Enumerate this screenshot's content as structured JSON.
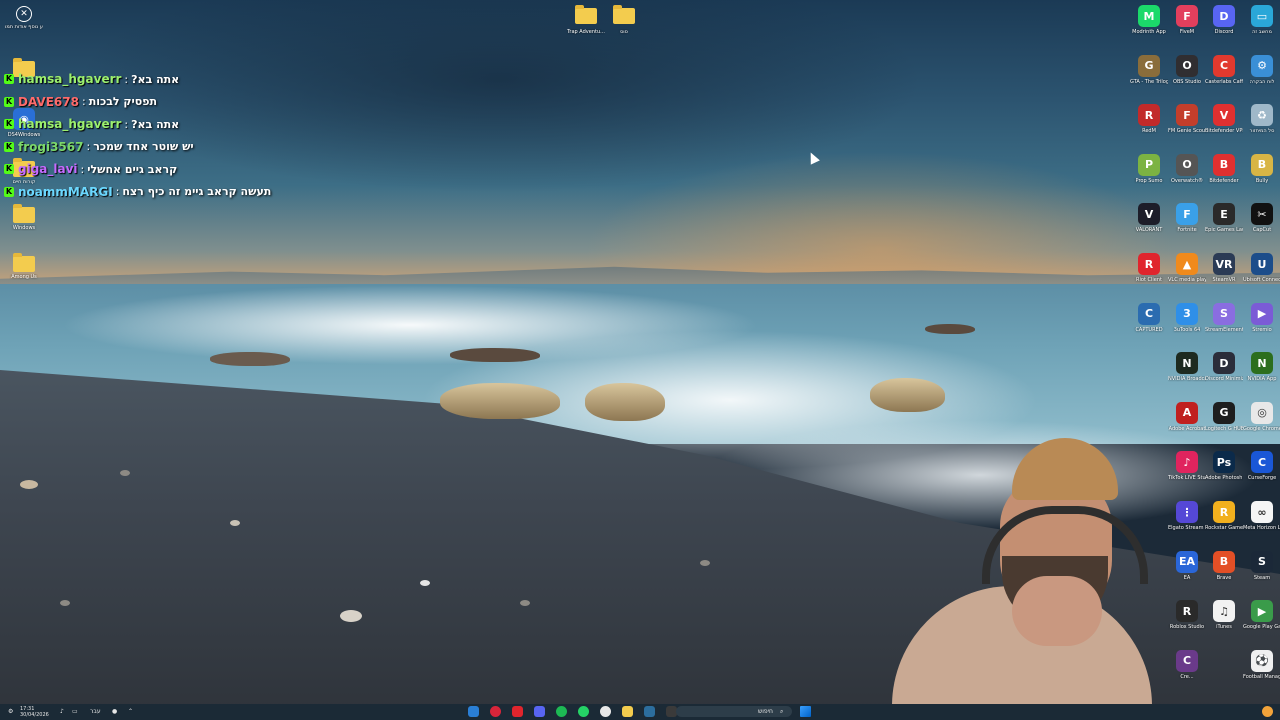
{
  "desktop": {
    "top_left_icons": [
      {
        "label": "מידע נוסף אודות תמו",
        "icon": "info-icon",
        "color": "#ffffff"
      },
      {
        "label": "",
        "icon": "folder-icon",
        "color": "#f3cc4e"
      },
      {
        "label": "DS4Windows",
        "icon": "gamepad-icon",
        "color": "#2a6fd6"
      },
      {
        "label": "קורות חיים",
        "icon": "folder-icon",
        "color": "#f3cc4e"
      },
      {
        "label": "Windows",
        "icon": "folder-icon",
        "color": "#f3cc4e"
      },
      {
        "label": "Among Us",
        "icon": "folder-icon",
        "color": "#f3cc4e"
      }
    ],
    "top_center_icons": [
      {
        "label": "Trap Adventu...",
        "icon": "folder-icon"
      },
      {
        "label": "סוס",
        "icon": "folder-icon"
      }
    ],
    "right_icons": [
      [
        {
          "label": "Modrinth App",
          "glyph": "M",
          "color": "#1bd96a"
        },
        {
          "label": "FiveM",
          "glyph": "F",
          "color": "#e23f5d"
        },
        {
          "label": "Discord",
          "glyph": "D",
          "color": "#5865f2"
        },
        {
          "label": "מחשב זה",
          "glyph": "▭",
          "color": "#2aa7d8"
        }
      ],
      [
        {
          "label": "GTA - The Trilogy - DE",
          "glyph": "G",
          "color": "#8a6d3b"
        },
        {
          "label": "OBS Studio",
          "glyph": "O",
          "color": "#302e31"
        },
        {
          "label": "Casterlabs Caffeinated",
          "glyph": "C",
          "color": "#e1392e"
        },
        {
          "label": "לוח הבקרה",
          "glyph": "⚙",
          "color": "#3a8fd6"
        }
      ],
      [
        {
          "label": "RedM",
          "glyph": "R",
          "color": "#c22a2a"
        },
        {
          "label": "FM Genie Scout 26g",
          "glyph": "F",
          "color": "#c33e2b"
        },
        {
          "label": "Bitdefender VPN",
          "glyph": "V",
          "color": "#e03030"
        },
        {
          "label": "סל המיחזור",
          "glyph": "♻",
          "color": "#9fb8c9"
        }
      ],
      [
        {
          "label": "Prop Sumo",
          "glyph": "P",
          "color": "#7cb342"
        },
        {
          "label": "Overwatch®",
          "glyph": "O",
          "color": "#555555"
        },
        {
          "label": "Bitdefender",
          "glyph": "B",
          "color": "#e03030"
        },
        {
          "label": "Bully",
          "glyph": "B",
          "color": "#d8b545"
        }
      ],
      [
        {
          "label": "VALORANT",
          "glyph": "V",
          "color": "#1d1d29"
        },
        {
          "label": "Fortnite",
          "glyph": "F",
          "color": "#3aa0e8"
        },
        {
          "label": "Epic Games Launcher",
          "glyph": "E",
          "color": "#2a2a2a"
        },
        {
          "label": "CapCut",
          "glyph": "✂",
          "color": "#111111"
        }
      ],
      [
        {
          "label": "Riot Client",
          "glyph": "R",
          "color": "#e0252d"
        },
        {
          "label": "VLC media player",
          "glyph": "▲",
          "color": "#f08a1c"
        },
        {
          "label": "SteamVR",
          "glyph": "VR",
          "color": "#2b3b55"
        },
        {
          "label": "Ubisoft Connect",
          "glyph": "U",
          "color": "#1c4d8a"
        }
      ],
      [
        {
          "label": "CAPTURED",
          "glyph": "C",
          "color": "#2b6cb0"
        },
        {
          "label": "3uTools 64",
          "glyph": "3",
          "color": "#2f8fe8"
        },
        {
          "label": "StreamElements SE.Live",
          "glyph": "S",
          "color": "#8a6de0"
        },
        {
          "label": "Stremio",
          "glyph": "▶",
          "color": "#7b5bd6"
        }
      ],
      [
        {
          "label": "",
          "glyph": "",
          "color": ""
        },
        {
          "label": "NVIDIA Broadcast",
          "glyph": "N",
          "color": "#1e2a20"
        },
        {
          "label": "Discord Minimizer",
          "glyph": "D",
          "color": "#2b2d3a"
        },
        {
          "label": "NVIDIA App",
          "glyph": "N",
          "color": "#2c6e1e"
        }
      ],
      [
        {
          "label": "",
          "glyph": "",
          "color": ""
        },
        {
          "label": "Adobe Acrobat",
          "glyph": "A",
          "color": "#c0201f"
        },
        {
          "label": "Logitech G HUB",
          "glyph": "G",
          "color": "#1e1e1e"
        },
        {
          "label": "Google Chrome",
          "glyph": "◎",
          "color": "#e8e8e8"
        }
      ],
      [
        {
          "label": "",
          "glyph": "",
          "color": ""
        },
        {
          "label": "TikTok LIVE Studio",
          "glyph": "♪",
          "color": "#e0245e"
        },
        {
          "label": "Adobe Photosh...",
          "glyph": "Ps",
          "color": "#0b2a4a"
        },
        {
          "label": "CurseForge",
          "glyph": "C",
          "color": "#1a57d6"
        }
      ],
      [
        {
          "label": "",
          "glyph": "",
          "color": ""
        },
        {
          "label": "Elgato Stream Deck",
          "glyph": "⋮",
          "color": "#5548d6"
        },
        {
          "label": "Rockstar Games...",
          "glyph": "R",
          "color": "#f2b01e"
        },
        {
          "label": "Meta Horizon Link",
          "glyph": "∞",
          "color": "#f5f5f5"
        }
      ],
      [
        {
          "label": "",
          "glyph": "",
          "color": ""
        },
        {
          "label": "EA",
          "glyph": "EA",
          "color": "#2a66d8"
        },
        {
          "label": "Brave",
          "glyph": "B",
          "color": "#e34f26"
        },
        {
          "label": "Steam",
          "glyph": "S",
          "color": "#1b2838"
        }
      ],
      [
        {
          "label": "",
          "glyph": "",
          "color": ""
        },
        {
          "label": "Roblox Studio",
          "glyph": "R",
          "color": "#2a2a2a"
        },
        {
          "label": "iTunes",
          "glyph": "♫",
          "color": "#f2f2f2"
        },
        {
          "label": "Google Play Games",
          "glyph": "▶",
          "color": "#3a9b4a"
        }
      ],
      [
        {
          "label": "",
          "glyph": "",
          "color": ""
        },
        {
          "label": "Cre...",
          "glyph": "C",
          "color": "#6a3a8a"
        },
        {
          "label": "",
          "glyph": "",
          "color": ""
        },
        {
          "label": "Football Manager 26",
          "glyph": "⚽",
          "color": "#f0f0f0"
        }
      ]
    ]
  },
  "chat": {
    "messages": [
      {
        "user": "hamsa_hgaverr",
        "message": "אתה בא?",
        "color": "#9cf06e"
      },
      {
        "user": "DAVE678",
        "message": "תפסיק לבכות",
        "color": "#ff6b6b"
      },
      {
        "user": "hamsa_hgaverr",
        "message": "אתה בא?",
        "color": "#9cf06e"
      },
      {
        "user": "frogi3567",
        "message": "יש שוטר אחד שמכר",
        "color": "#7bd86b"
      },
      {
        "user": "giga_lavi",
        "message": "קראב גיים אחשלי",
        "color": "#c56bff"
      },
      {
        "user": "noammMARGI",
        "message": "תעשה קראב גיימ זה כיף רצח",
        "color": "#6bd8ff"
      }
    ]
  },
  "taskbar": {
    "time": "17:31",
    "date": "30/04/2026",
    "language": "עבר",
    "search_placeholder": "חיפוש",
    "start_label": "Start"
  }
}
